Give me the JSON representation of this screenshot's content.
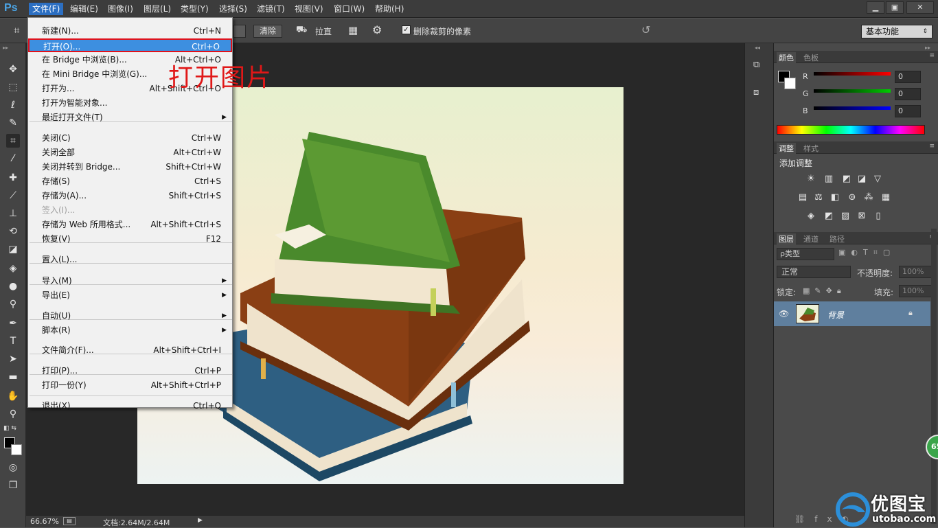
{
  "app": {
    "logo": "Ps"
  },
  "menubar": {
    "items": [
      "文件(F)",
      "编辑(E)",
      "图像(I)",
      "图层(L)",
      "类型(Y)",
      "选择(S)",
      "滤镜(T)",
      "视图(V)",
      "窗口(W)",
      "帮助(H)"
    ],
    "active": "文件(F)"
  },
  "window_controls": {
    "minimize": "▁",
    "restore": "▣",
    "close": "✕"
  },
  "options": {
    "clear_button": "清除",
    "straighten_label": "拉直",
    "delete_cropped_label": "删除裁剪的像素",
    "delete_cropped_checked": true,
    "workspace": "基本功能"
  },
  "file_menu": {
    "items": [
      {
        "label": "新建(N)...",
        "shortcut": "Ctrl+N"
      },
      {
        "label": "打开(O)...",
        "shortcut": "Ctrl+O",
        "highlight": true
      },
      {
        "label": "在 Bridge 中浏览(B)...",
        "shortcut": "Alt+Ctrl+O"
      },
      {
        "label": "在 Mini Bridge 中浏览(G)...",
        "shortcut": ""
      },
      {
        "label": "打开为...",
        "shortcut": "Alt+Shift+Ctrl+O"
      },
      {
        "label": "打开为智能对象...",
        "shortcut": ""
      },
      {
        "label": "最近打开文件(T)",
        "shortcut": "",
        "submenu": true
      },
      {
        "label": "关闭(C)",
        "shortcut": "Ctrl+W"
      },
      {
        "label": "关闭全部",
        "shortcut": "Alt+Ctrl+W"
      },
      {
        "label": "关闭并转到 Bridge...",
        "shortcut": "Shift+Ctrl+W"
      },
      {
        "label": "存储(S)",
        "shortcut": "Ctrl+S"
      },
      {
        "label": "存储为(A)...",
        "shortcut": "Shift+Ctrl+S"
      },
      {
        "label": "签入(I)...",
        "shortcut": "",
        "disabled": true
      },
      {
        "label": "存储为 Web 所用格式...",
        "shortcut": "Alt+Shift+Ctrl+S"
      },
      {
        "label": "恢复(V)",
        "shortcut": "F12"
      },
      {
        "label": "置入(L)...",
        "shortcut": ""
      },
      {
        "label": "导入(M)",
        "shortcut": "",
        "submenu": true
      },
      {
        "label": "导出(E)",
        "shortcut": "",
        "submenu": true
      },
      {
        "label": "自动(U)",
        "shortcut": "",
        "submenu": true
      },
      {
        "label": "脚本(R)",
        "shortcut": "",
        "submenu": true
      },
      {
        "label": "文件简介(F)...",
        "shortcut": "Alt+Shift+Ctrl+I"
      },
      {
        "label": "打印(P)...",
        "shortcut": "Ctrl+P"
      },
      {
        "label": "打印一份(Y)",
        "shortcut": "Alt+Shift+Ctrl+P"
      },
      {
        "label": "退出(X)",
        "shortcut": "Ctrl+Q"
      }
    ]
  },
  "annotation": "打开图片",
  "status": {
    "zoom": "66.67%",
    "doc": "文档:2.64M/2.64M"
  },
  "color_panel": {
    "tabs": [
      "颜色",
      "色板"
    ],
    "channels": [
      {
        "name": "R",
        "value": "0"
      },
      {
        "name": "G",
        "value": "0"
      },
      {
        "name": "B",
        "value": "0"
      }
    ]
  },
  "adjust_panel": {
    "tabs": [
      "调整",
      "样式"
    ],
    "title": "添加调整"
  },
  "layers_panel": {
    "tabs": [
      "图层",
      "通道",
      "路径"
    ],
    "filter_kind": "ρ类型",
    "blend_mode": "正常",
    "opacity_label": "不透明度:",
    "opacity_value": "100%",
    "lock_label": "锁定:",
    "fill_label": "填充:",
    "fill_value": "100%",
    "layer_name": "背景"
  },
  "watermark": {
    "brand": "优图宝",
    "url": "utobao.com"
  },
  "badge": "65",
  "colors": {
    "menu_highlight": "#3d8fe0",
    "annotation_red": "#e01818",
    "ps_blue": "#4ba6e8"
  }
}
